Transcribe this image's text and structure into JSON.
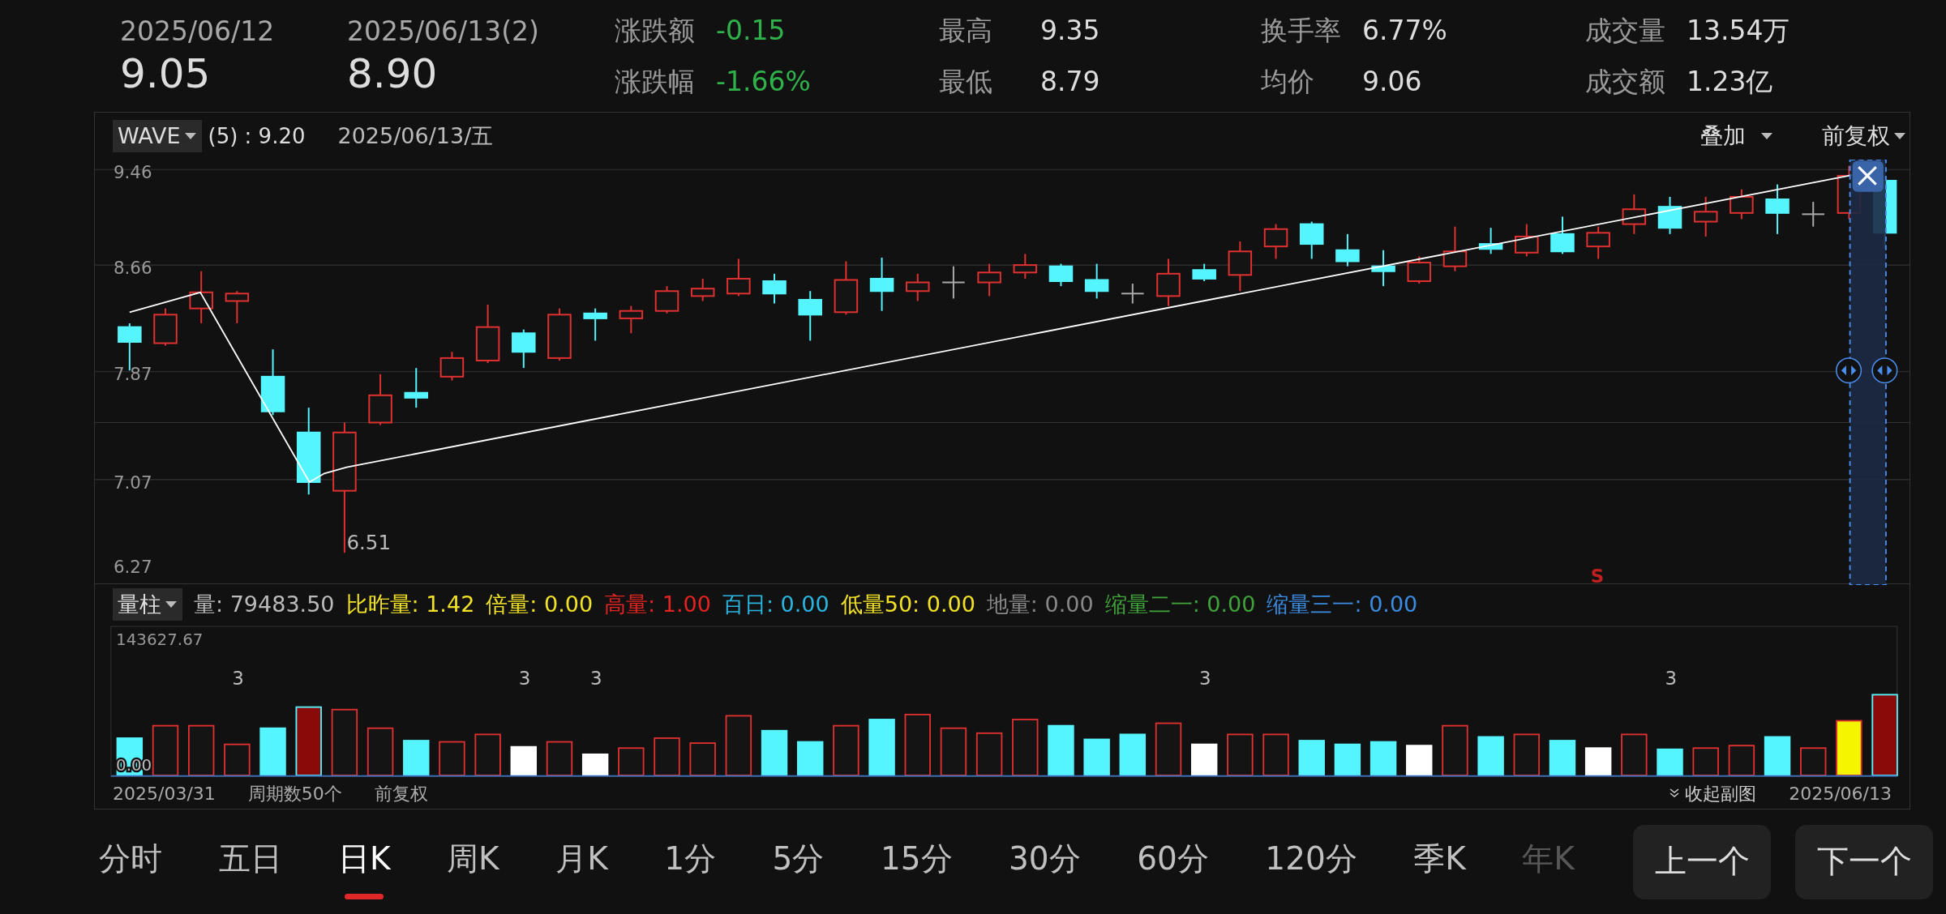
{
  "header": {
    "previous": {
      "date": "2025/06/12",
      "price": "9.05"
    },
    "current": {
      "date": "2025/06/13(2)",
      "price": "8.90"
    },
    "stats": [
      {
        "label": "涨跌额",
        "value": "-0.15",
        "kind": "down"
      },
      {
        "label": "最高",
        "value": "9.35",
        "kind": "plain"
      },
      {
        "label": "换手率",
        "value": "6.77%",
        "kind": "plain"
      },
      {
        "label": "成交量",
        "value": "13.54万",
        "kind": "plain"
      },
      {
        "label": "涨跌幅",
        "value": "-1.66%",
        "kind": "down"
      },
      {
        "label": "最低",
        "value": "8.79",
        "kind": "plain"
      },
      {
        "label": "均价",
        "value": "9.06",
        "kind": "plain"
      },
      {
        "label": "成交额",
        "value": "1.23亿",
        "kind": "plain"
      }
    ]
  },
  "chart_toolbar": {
    "indicator": "WAVE",
    "reading": "(5) : 9.20",
    "date": "2025/06/13/五",
    "overlay": "叠加",
    "adjust": "前复权"
  },
  "price_chart": {
    "y_labels": [
      "9.46",
      "8.66",
      "7.87",
      "7.07",
      "6.27"
    ],
    "low_label": "6.51",
    "signal": "S"
  },
  "volume_toolbar": {
    "indicator": "量柱",
    "items": [
      {
        "text": "量: 79483.50",
        "color": "#bbbbbb"
      },
      {
        "text": "比昨量: 1.42",
        "color": "#f2e227"
      },
      {
        "text": "倍量: 0.00",
        "color": "#f2e227"
      },
      {
        "text": "高量: 1.00",
        "color": "#e32222"
      },
      {
        "text": "百日: 0.00",
        "color": "#2ab6e0"
      },
      {
        "text": "低量50: 0.00",
        "color": "#f2e227"
      },
      {
        "text": "地量: 0.00",
        "color": "#888888"
      },
      {
        "text": "缩量二一: 0.00",
        "color": "#3fa23a"
      },
      {
        "text": "缩量三一: 0.00",
        "color": "#3b8be0"
      }
    ]
  },
  "volume_chart": {
    "top_label": "143627.67",
    "bottom_label": "0.00",
    "markers": [
      "3",
      "3",
      "3",
      "3",
      "3"
    ]
  },
  "footer": {
    "start_date": "2025/03/31",
    "periods": "周期数50个",
    "adjust": "前复权",
    "collapse": "收起副图",
    "end_date": "2025/06/13"
  },
  "tabs": [
    {
      "label": "分时",
      "selected": false,
      "faded": false
    },
    {
      "label": "五日",
      "selected": false,
      "faded": false
    },
    {
      "label": "日K",
      "selected": true,
      "faded": false
    },
    {
      "label": "周K",
      "selected": false,
      "faded": false
    },
    {
      "label": "月K",
      "selected": false,
      "faded": false
    },
    {
      "label": "1分",
      "selected": false,
      "faded": false
    },
    {
      "label": "5分",
      "selected": false,
      "faded": false
    },
    {
      "label": "15分",
      "selected": false,
      "faded": false
    },
    {
      "label": "30分",
      "selected": false,
      "faded": false
    },
    {
      "label": "60分",
      "selected": false,
      "faded": false
    },
    {
      "label": "120分",
      "selected": false,
      "faded": false
    },
    {
      "label": "季K",
      "selected": false,
      "faded": false
    },
    {
      "label": "年K",
      "selected": false,
      "faded": true
    }
  ],
  "nav_buttons": [
    "上一个",
    "下一个"
  ]
}
